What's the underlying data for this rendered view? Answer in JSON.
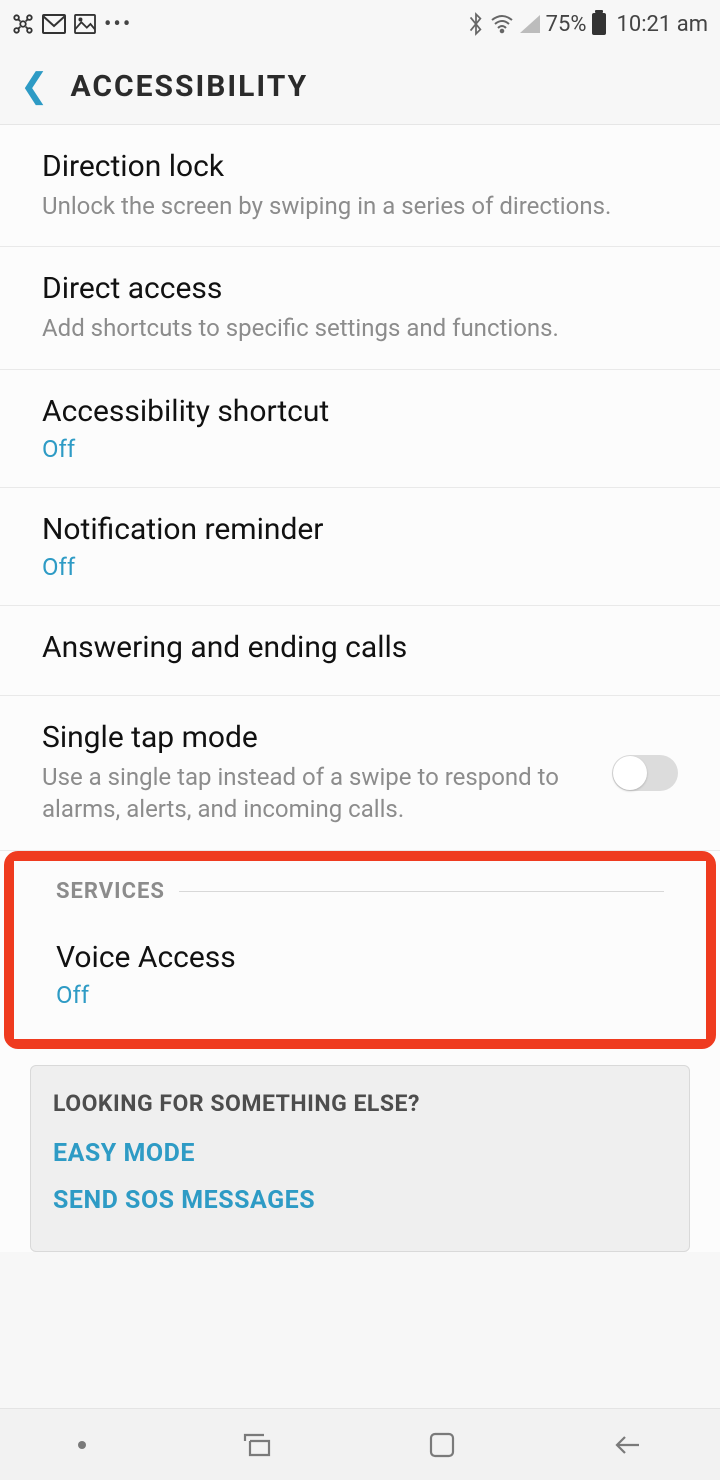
{
  "status": {
    "battery": "75%",
    "time": "10:21 am"
  },
  "header": {
    "title": "ACCESSIBILITY"
  },
  "items": {
    "direction_lock": {
      "title": "Direction lock",
      "sub": "Unlock the screen by swiping in a series of directions."
    },
    "direct_access": {
      "title": "Direct access",
      "sub": "Add shortcuts to specific settings and functions."
    },
    "accessibility_shortcut": {
      "title": "Accessibility shortcut",
      "state": "Off"
    },
    "notification_reminder": {
      "title": "Notification reminder",
      "state": "Off"
    },
    "answering": {
      "title": "Answering and ending calls"
    },
    "single_tap": {
      "title": "Single tap mode",
      "sub": "Use a single tap instead of a swipe to respond to alarms, alerts, and incoming calls."
    }
  },
  "services": {
    "label": "SERVICES",
    "voice_access": {
      "title": "Voice Access",
      "state": "Off"
    }
  },
  "footer": {
    "title": "LOOKING FOR SOMETHING ELSE?",
    "link1": "EASY MODE",
    "link2": "SEND SOS MESSAGES"
  }
}
